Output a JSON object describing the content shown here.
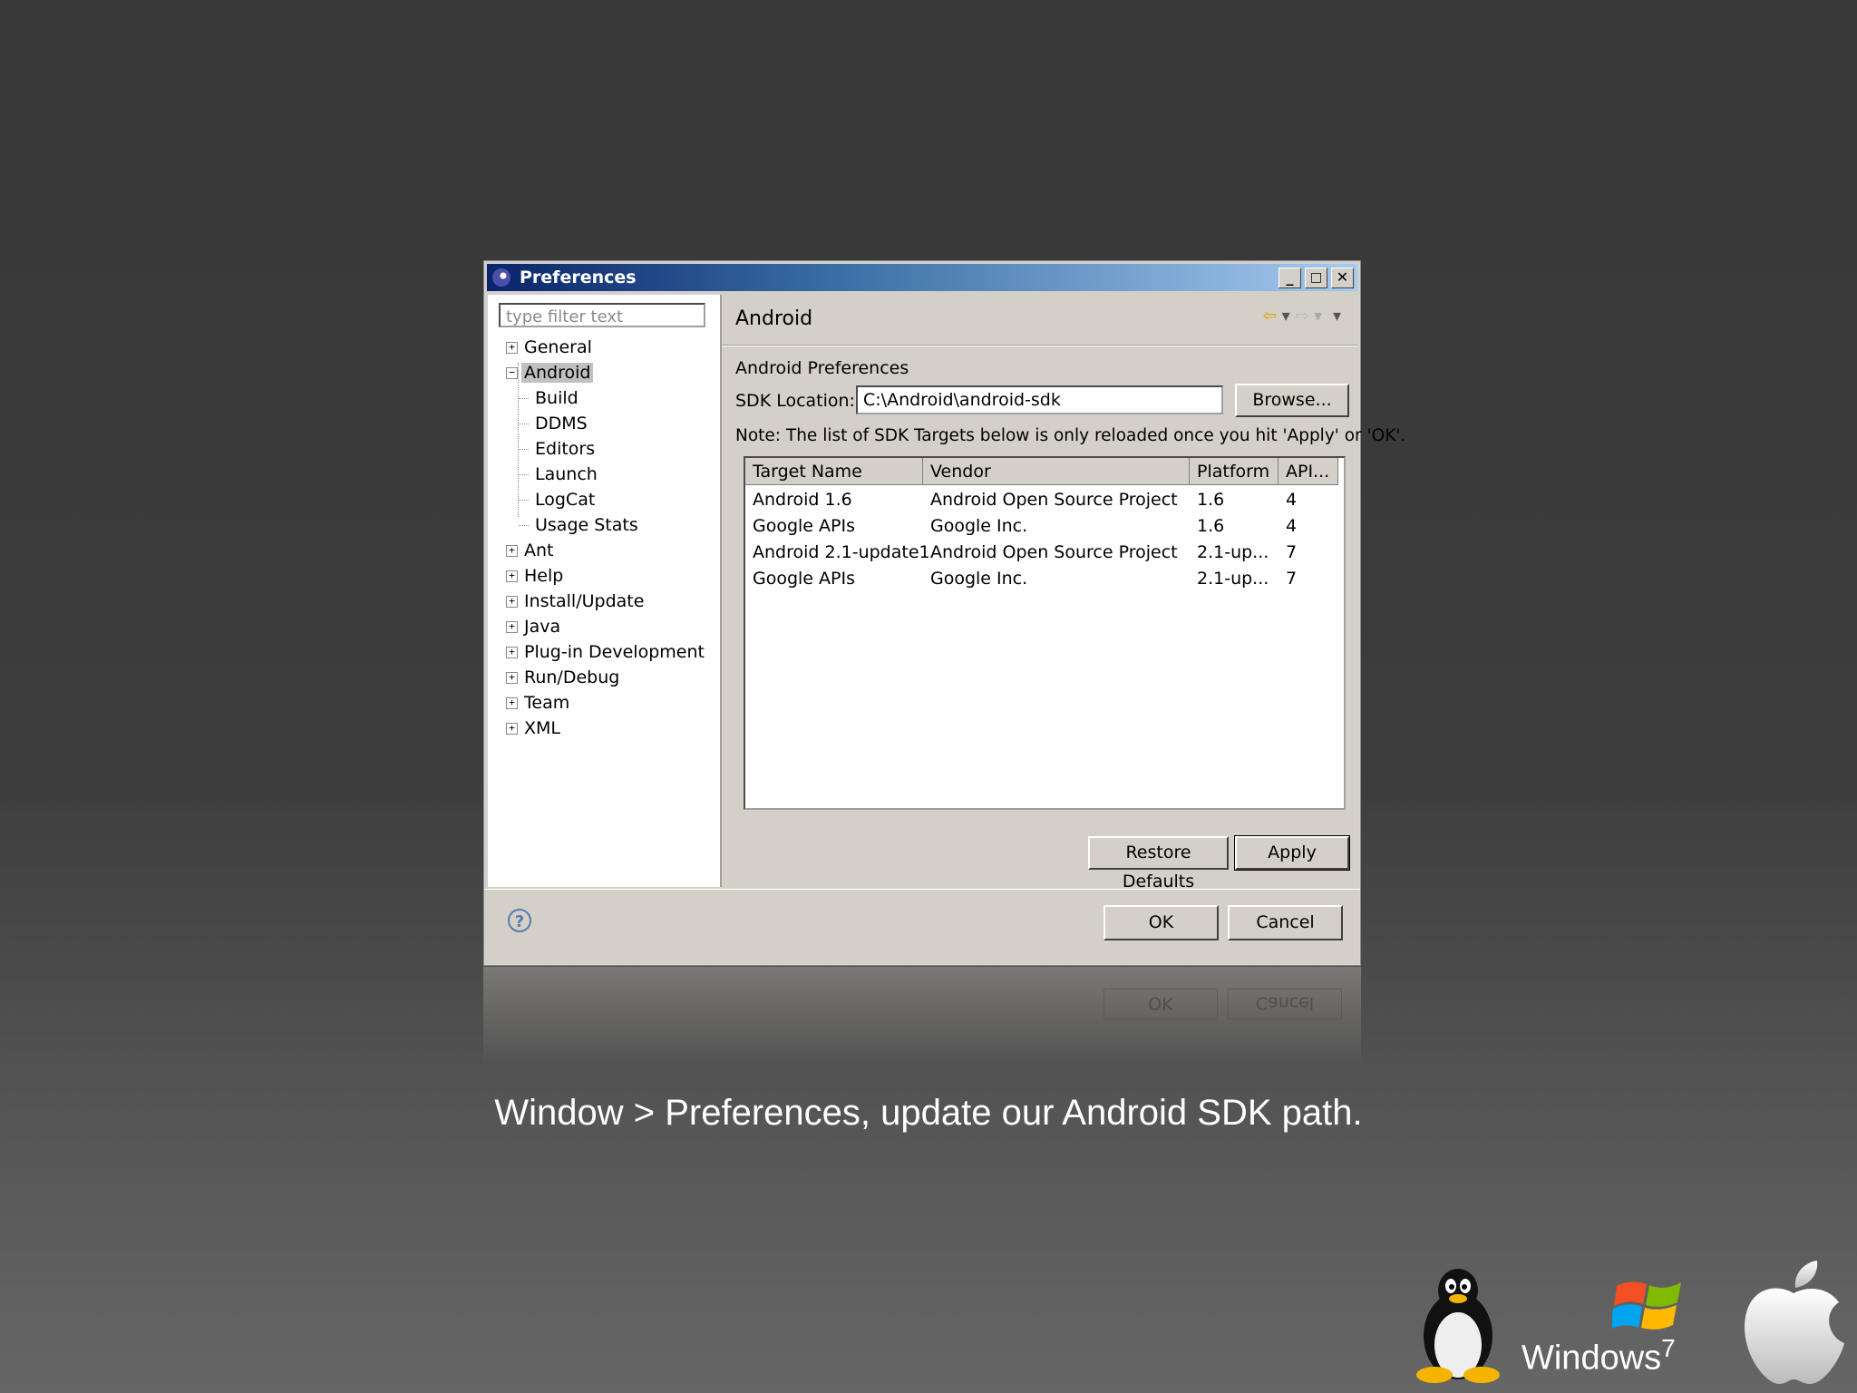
{
  "window": {
    "title": "Preferences",
    "minimize": "_",
    "maximize": "□",
    "close": "✕"
  },
  "filter": {
    "placeholder": "type filter text"
  },
  "tree": {
    "items": [
      {
        "label": "General"
      },
      {
        "label": "Android"
      },
      {
        "label": "Build"
      },
      {
        "label": "DDMS"
      },
      {
        "label": "Editors"
      },
      {
        "label": "Launch"
      },
      {
        "label": "LogCat"
      },
      {
        "label": "Usage Stats"
      },
      {
        "label": "Ant"
      },
      {
        "label": "Help"
      },
      {
        "label": "Install/Update"
      },
      {
        "label": "Java"
      },
      {
        "label": "Plug-in Development"
      },
      {
        "label": "Run/Debug"
      },
      {
        "label": "Team"
      },
      {
        "label": "XML"
      }
    ]
  },
  "page": {
    "title": "Android",
    "section": "Android Preferences",
    "sdk_label": "SDK Location:",
    "sdk_value": "C:\\Android\\android-sdk",
    "browse": "Browse...",
    "note": "Note: The list of SDK Targets below is only reloaded once you hit 'Apply' or 'OK'.",
    "table": {
      "headers": [
        "Target Name",
        "Vendor",
        "Platform",
        "API..."
      ],
      "rows": [
        [
          "Android 1.6",
          "Android Open Source Project",
          "1.6",
          "4"
        ],
        [
          "Google APIs",
          "Google Inc.",
          "1.6",
          "4"
        ],
        [
          "Android 2.1-update1",
          "Android Open Source Project",
          "2.1-up...",
          "7"
        ],
        [
          "Google APIs",
          "Google Inc.",
          "2.1-up...",
          "7"
        ]
      ]
    },
    "restore_defaults": "Restore Defaults",
    "apply": "Apply"
  },
  "footer": {
    "help": "?",
    "ok": "OK",
    "cancel": "Cancel"
  },
  "reflection": {
    "ok": "OK",
    "cancel": "Cancel"
  },
  "caption": "Window > Preferences, update our Android SDK path.",
  "logos": {
    "windows_text": "Windows",
    "windows_version": "7",
    "icons": [
      "tux-icon",
      "windows-flag-icon",
      "apple-icon"
    ]
  }
}
